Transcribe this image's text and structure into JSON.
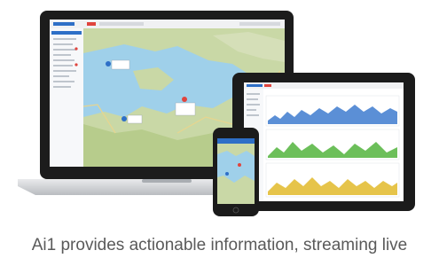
{
  "caption": "Ai1 provides actionable information, streaming live",
  "colors": {
    "accent": "#2e6fc7",
    "alert": "#e0443e",
    "lake": "#9fd0ea",
    "land": "#c9d8a6",
    "device_dark": "#1b1b1b"
  },
  "icons": {
    "laptop": "laptop-icon",
    "tablet": "tablet-icon",
    "phone": "phone-icon",
    "map_marker": "map-marker-icon"
  }
}
